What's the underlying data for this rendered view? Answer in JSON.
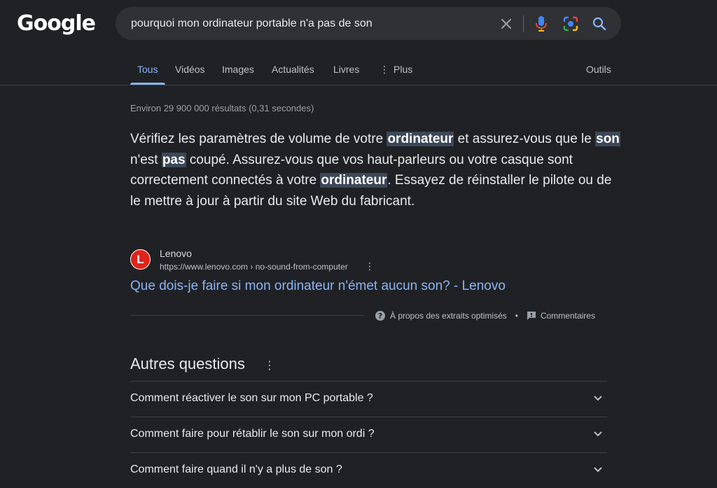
{
  "logo": "Google",
  "search": {
    "query": "pourquoi mon ordinateur portable n'a pas de son"
  },
  "tabs": [
    {
      "label": "Tous"
    },
    {
      "label": "Vidéos"
    },
    {
      "label": "Images"
    },
    {
      "label": "Actualités"
    },
    {
      "label": "Livres"
    },
    {
      "label": "Plus"
    }
  ],
  "tools_label": "Outils",
  "stats": "Environ 29 900 000 résultats (0,31 secondes)",
  "snippet": {
    "p1": "Vérifiez les paramètres de volume de votre ",
    "h1": "ordinateur",
    "p2": " et assurez-vous que le ",
    "h2": "son",
    "p3": " n'est ",
    "h3": "pas",
    "p4": " coupé. Assurez-vous que vos haut-parleurs ou votre casque sont correctement connectés à votre ",
    "h4": "ordinateur",
    "p5": ". Essayez de réinstaller le pilote ou de le mettre à jour à partir du site Web du fabricant."
  },
  "source": {
    "favicon_letter": "L",
    "name": "Lenovo",
    "url": "https://www.lenovo.com › no-sound-from-computer",
    "title": "Que dois-je faire si mon ordinateur n'émet aucun son? - Lenovo"
  },
  "about": {
    "label": "À propos des extraits optimisés",
    "separator": "•",
    "feedback": "Commentaires"
  },
  "paa": {
    "title": "Autres questions",
    "questions": [
      "Comment réactiver le son sur mon PC portable ?",
      "Comment faire pour rétablir le son sur mon ordi ?",
      "Comment faire quand il n'y a plus de son ?"
    ]
  },
  "colors": {
    "background": "#202124",
    "link": "#8ab4f8",
    "text": "#e8eaed",
    "favicon": "#e2231a"
  }
}
